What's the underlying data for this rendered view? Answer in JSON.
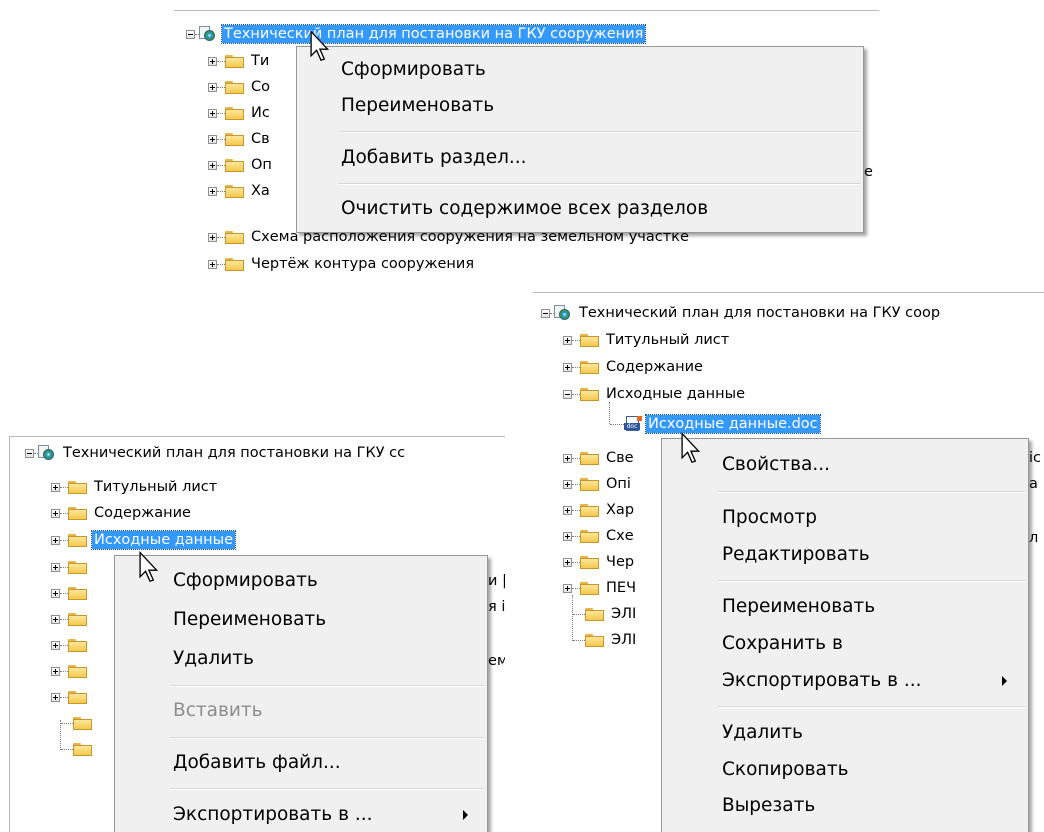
{
  "panel_top": {
    "root_label": "Технический план для постановки на ГКУ сооружения",
    "partial_items": [
      "Ти",
      "Со",
      "Ис",
      "Св",
      "Оп",
      "Ха"
    ],
    "items_below": [
      "Схема расположения сооружения на земельном участке",
      "Чертёж контура сооружения"
    ],
    "behind_menu_fragment": "е",
    "context_menu": {
      "sformirovat": "Сформировать",
      "pereimenovat": "Переименовать",
      "dobavit_razdel": "Добавить раздел...",
      "ochistit": "Очистить содержимое всех разделов"
    }
  },
  "panel_left": {
    "root_label": "Технический план для постановки на ГКУ сс",
    "items": [
      "Титульный лист",
      "Содержание",
      "Исходные данные"
    ],
    "behind_menu_fragments": [
      "и |",
      "я і",
      "ем"
    ],
    "context_menu": {
      "sformirovat": "Сформировать",
      "pereimenovat": "Переименовать",
      "udalit": "Удалить",
      "vstavit": "Вставить",
      "dobavit_fail": "Добавить файл...",
      "eksportirovat": "Экспортировать в ..."
    }
  },
  "panel_right": {
    "root_label": "Технический план для постановки на ГКУ соор",
    "items": [
      "Титульный лист",
      "Содержание",
      "Исходные данные"
    ],
    "file_label": "Исходные данные.doc",
    "partial_items": [
      "Све",
      "Опі",
      "Хар",
      "Схе",
      "Чер",
      "ПЕЧ",
      "ЭЛІ",
      "ЭЛІ"
    ],
    "behind_menu_fragments": [
      "іс",
      "а",
      "л"
    ],
    "context_menu": {
      "svoistva": "Свойства...",
      "prosmotr": "Просмотр",
      "redaktirovat": "Редактировать",
      "pereimenovat": "Переименовать",
      "sohranit": "Сохранить в",
      "eksportirovat": "Экспортировать в ...",
      "udalit": "Удалить",
      "skopirovat": "Скопировать",
      "vyrezat": "Вырезать"
    }
  },
  "colors": {
    "selection": "#3399ff",
    "menu_bg": "#f0f0f0",
    "disabled_text": "#8d8d8d"
  },
  "icons": [
    "root-plan-icon",
    "folder-icon",
    "doc-file-icon",
    "expand-plus-icon",
    "collapse-minus-icon",
    "mouse-cursor-icon",
    "submenu-arrow-icon"
  ]
}
